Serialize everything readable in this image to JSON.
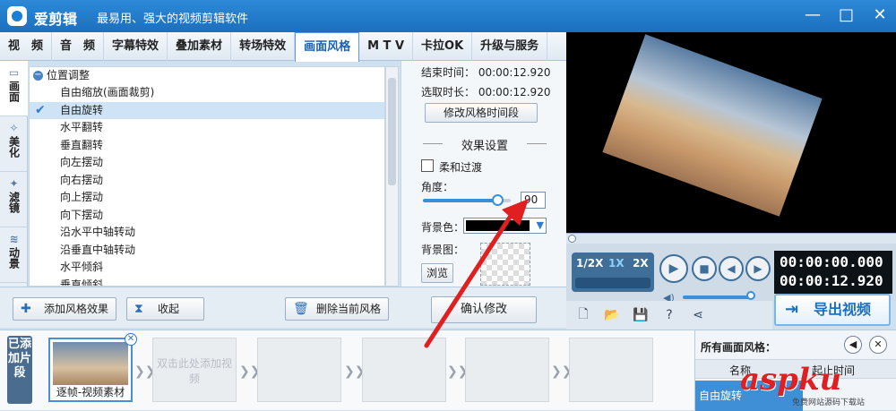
{
  "app": {
    "title": "爱剪辑",
    "slogan": "最易用、强大的视频剪辑软件",
    "window_buttons": {
      "minimize": "—",
      "maximize": "□",
      "close": "✕"
    }
  },
  "tabs": [
    "视　频",
    "音　频",
    "字幕特效",
    "叠加素材",
    "转场特效",
    "画面风格",
    "M T V",
    "卡拉OK",
    "升级与服务"
  ],
  "active_tab": "画面风格",
  "side_tabs": [
    {
      "label": "画面",
      "icon": "▭"
    },
    {
      "label": "美化",
      "icon": "✧"
    },
    {
      "label": "滤镜",
      "icon": "✦"
    },
    {
      "label": "动景",
      "icon": "≋"
    }
  ],
  "style_list": {
    "group": "位置调整",
    "items": [
      "自由缩放(画面裁剪)",
      "自由旋转",
      "水平翻转",
      "垂直翻转",
      "向左摆动",
      "向右摆动",
      "向上摆动",
      "向下摆动",
      "沿水平中轴转动",
      "沿垂直中轴转动",
      "水平倾斜",
      "垂直倾斜"
    ],
    "selected": "自由旋转"
  },
  "settings": {
    "end_time_label": "结束时间：",
    "end_time": "00:00:12.920",
    "duration_label": "选取时长：",
    "duration": "00:00:12.920",
    "modify_time_button": "修改风格时间段",
    "effect_title": "效果设置",
    "smooth_transition": "柔和过渡",
    "angle_label": "角度：",
    "angle_value": "90",
    "angle_slider_fraction": 0.85,
    "bg_color_label": "背景色：",
    "bg_color": "#000000",
    "bg_image_label": "背景图：",
    "browse_button": "浏览",
    "confirm_button": "确认修改"
  },
  "toolbar": {
    "add_effect": "添加风格效果",
    "collapse": "收起",
    "delete_style": "删除当前风格"
  },
  "player": {
    "speeds": [
      "1/2X",
      "1X",
      "2X"
    ],
    "active_speed": "1X",
    "current_time": "00:00:00.000",
    "total_time": "00:00:12.920",
    "volume_fraction": 0.9,
    "export_label": "导出视频"
  },
  "timeline": {
    "label": "已添加片段",
    "first_clip_caption": "逐帧-视频素材",
    "placeholder_text": "双击此处添加视频",
    "empty_slots": 4
  },
  "styles_panel": {
    "title": "所有画面风格：",
    "col_name": "名称",
    "col_time": "起止时间",
    "row_name": "自由旋转"
  },
  "watermark": {
    "main": "aspku",
    "sub": "免费网站源码下载站"
  },
  "colors": {
    "accent": "#1b6fbe",
    "highlight_row": "#cfe3f7",
    "annotation_arrow": "#e02020"
  }
}
